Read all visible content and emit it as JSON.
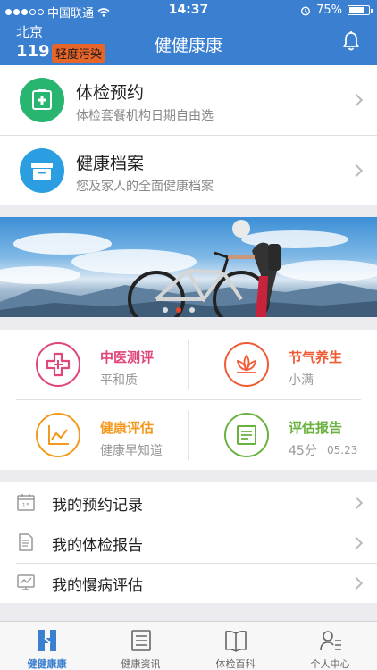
{
  "status_bar": {
    "carrier": "中国联通",
    "time": "14:37",
    "battery": "75%",
    "battery_level": 0.75
  },
  "header": {
    "city": "北京",
    "aqi_value": "119",
    "aqi_level": "轻度污染",
    "title": "健健康康"
  },
  "cards": [
    {
      "title": "体检预约",
      "subtitle": "体检套餐机构日期自由选",
      "icon": "hospital-icon",
      "color": "#27b56f"
    },
    {
      "title": "健康档案",
      "subtitle": "您及家人的全面健康档案",
      "icon": "archive-icon",
      "color": "#2a9ee0"
    }
  ],
  "banner": {
    "icon": "cyclist-photo",
    "active_dot": 1,
    "dot_count": 3
  },
  "grid": [
    {
      "title": "中医测评",
      "value": "平和质",
      "icon": "medical-cross-icon",
      "color": "#e0457b"
    },
    {
      "title": "节气养生",
      "value": "小满",
      "icon": "lotus-icon",
      "color": "#f05a35"
    },
    {
      "title": "健康评估",
      "value": "健康早知道",
      "icon": "trend-chart-icon",
      "color": "#f39a1e"
    },
    {
      "title": "评估报告",
      "value": "45分",
      "date": "05.23",
      "icon": "report-icon",
      "color": "#6ab23f"
    }
  ],
  "list": [
    {
      "label": "我的预约记录",
      "icon": "calendar-icon"
    },
    {
      "label": "我的体检报告",
      "icon": "document-icon"
    },
    {
      "label": "我的慢病评估",
      "icon": "monitor-chart-icon"
    }
  ],
  "tabs": [
    {
      "label": "健健康康",
      "icon": "home-logo-icon",
      "active": true
    },
    {
      "label": "健康资讯",
      "icon": "news-icon",
      "active": false
    },
    {
      "label": "体检百科",
      "icon": "book-icon",
      "active": false
    },
    {
      "label": "个人中心",
      "icon": "profile-icon",
      "active": false
    }
  ],
  "colors": {
    "brand": "#3a7fd0",
    "aqi_badge": "#e8652a"
  }
}
